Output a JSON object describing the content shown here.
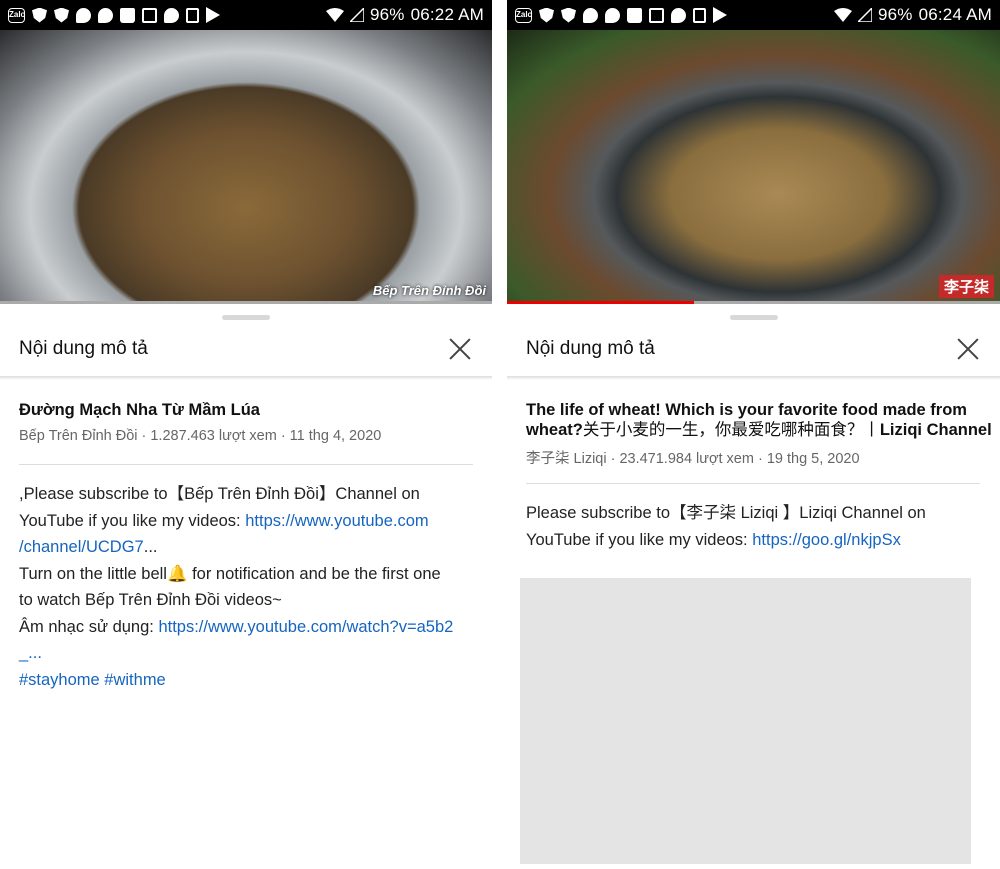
{
  "left": {
    "status": {
      "battery": "96%",
      "time": "06:22 AM"
    },
    "video": {
      "watermark": "Bếp Trên Đỉnh Đồi",
      "progress_fraction": 0.0
    },
    "sheet": {
      "title": "Nội dung mô tả",
      "video_title": "Đường Mạch Nha Từ Mầm Lúa",
      "meta": "Bếp Trên Đỉnh Đồi · 1.287.463 lượt xem · 11 thg 4, 2020",
      "desc": {
        "l1": ",Please subscribe to【Bếp Trên Đỉnh Đồi】Channel on",
        "l2_text": "YouTube if you like my videos: ",
        "l2_link": "https://www.youtube.com",
        "l3_link": "/channel/UCDG7",
        "l3_text": "...",
        "l4": "Turn on the little bell🔔  for notification and be the first one",
        "l5": "to watch Bếp Trên Đỉnh Đồi videos~",
        "l6_text": "Âm nhạc sử dụng: ",
        "l6_link": "https://www.youtube.com/watch?v=a5b2",
        "l7_link": "_...",
        "hashtags": "#stayhome #withme"
      }
    }
  },
  "right": {
    "status": {
      "battery": "96%",
      "time": "06:24 AM"
    },
    "video": {
      "watermark": "李子柒",
      "progress_fraction": 0.38
    },
    "sheet": {
      "title": "Nội dung mô tả",
      "video_title_1": "The life of wheat! Which is your favorite food made from",
      "video_title_2_a": "wheat?",
      "video_title_2_b": "关于小麦的一生，你最爱吃哪种面食？丨",
      "video_title_2_c": "Liziqi Channel",
      "meta": "李子柒 Liziqi · 23.471.984 lượt xem · 19 thg 5, 2020",
      "desc": {
        "l1": "Please  subscribe to【李子柒 Liziqi 】Liziqi Channel on",
        "l2_text": "YouTube if you like my videos: ",
        "l2_link": "https://goo.gl/nkjpSx"
      }
    }
  },
  "colors": {
    "link": "#1565c0",
    "progress": "#e00000"
  }
}
